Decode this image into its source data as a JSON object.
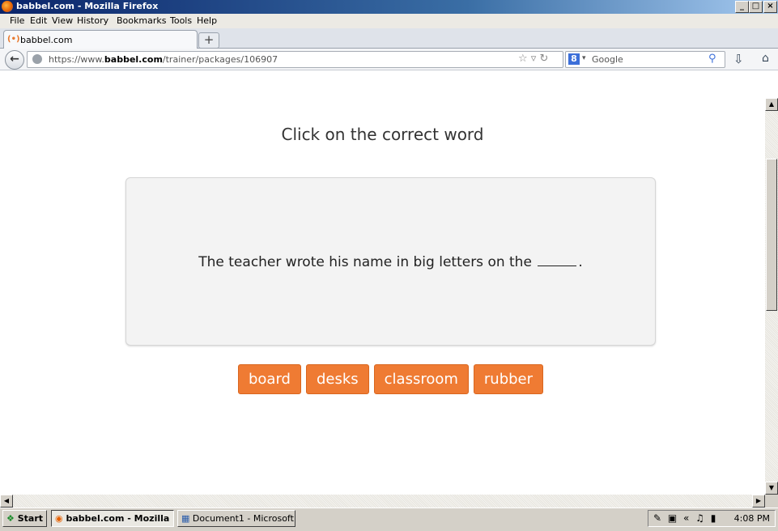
{
  "window": {
    "title": "babbel.com - Mozilla Firefox",
    "buttons": {
      "minimize": "_",
      "maximize": "□",
      "close": "×"
    }
  },
  "menu": [
    "File",
    "Edit",
    "View",
    "History",
    "Bookmarks",
    "Tools",
    "Help"
  ],
  "tab": {
    "title": "babbel.com",
    "new_tab": "+"
  },
  "nav": {
    "url_prefix": "https://www.",
    "url_domain": "babbel.com",
    "url_path": "/trainer/packages/106907",
    "search_engine": "8",
    "search_placeholder": "Google"
  },
  "exercise": {
    "instruction": "Click on the correct word",
    "sentence_before": "The teacher wrote his name in big letters on the",
    "sentence_after": ".",
    "answers": [
      "board",
      "desks",
      "classroom",
      "rubber"
    ]
  },
  "taskbar": {
    "start_label": "Start",
    "tasks": [
      "babbel.com - Mozilla ...",
      "Document1 - Microsoft ..."
    ],
    "clock": "4:08 PM"
  },
  "colors": {
    "answer_button": "#ef7b33",
    "card_bg": "#f3f3f3"
  }
}
